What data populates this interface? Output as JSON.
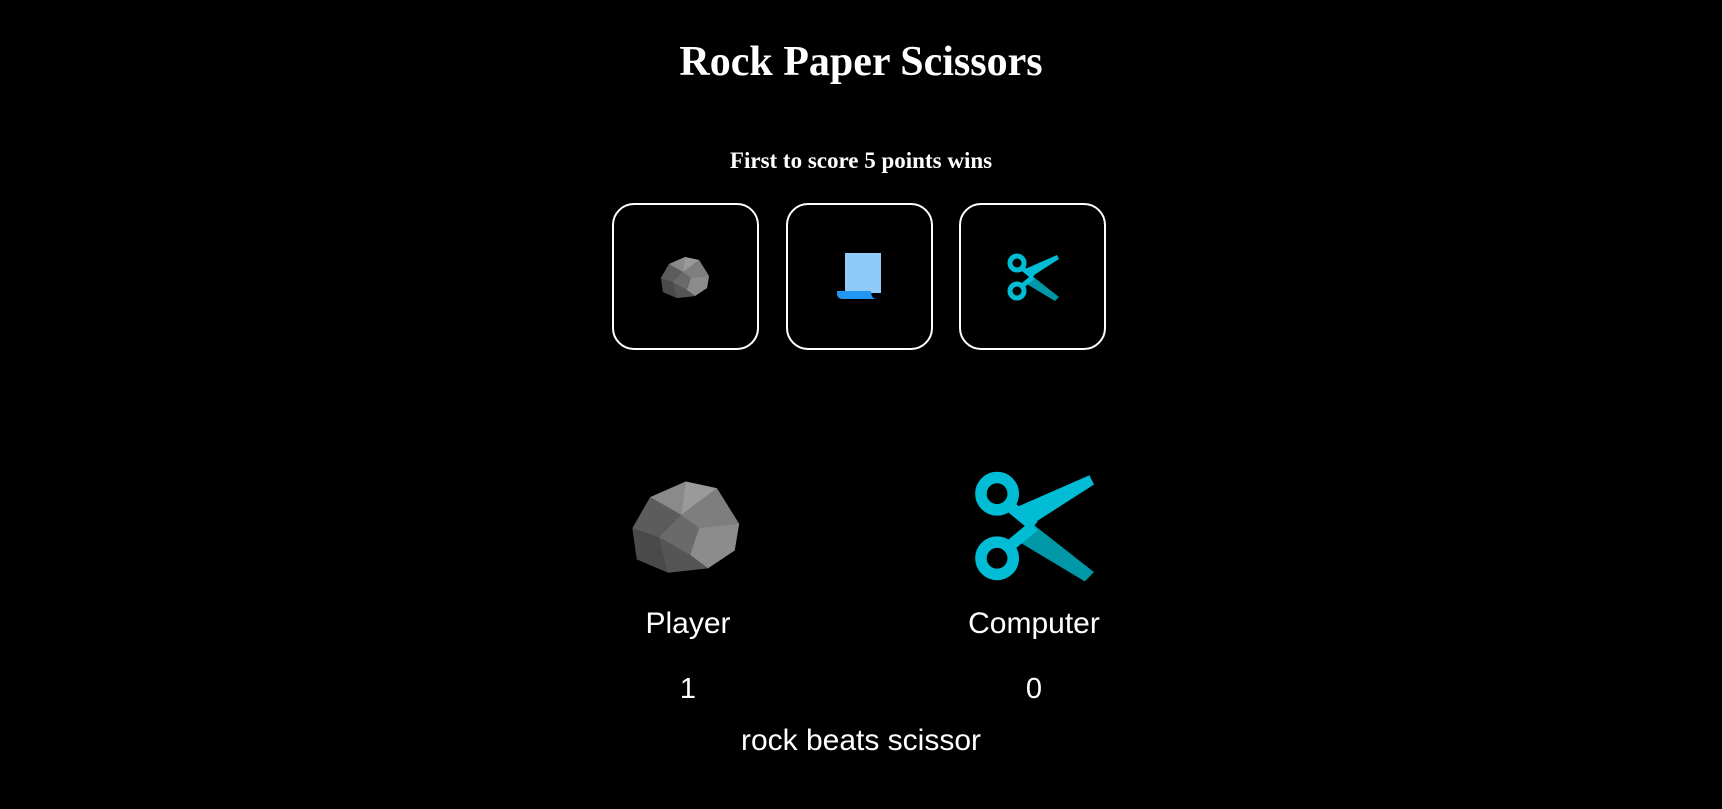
{
  "title": "Rock Paper Scissors",
  "subtitle": "First to score 5 points wins",
  "choices": [
    {
      "name": "rock",
      "icon": "rock-icon"
    },
    {
      "name": "paper",
      "icon": "paper-icon"
    },
    {
      "name": "scissors",
      "icon": "scissors-icon"
    }
  ],
  "player": {
    "label": "Player",
    "score": "1",
    "pick_icon": "rock-icon"
  },
  "computer": {
    "label": "Computer",
    "score": "0",
    "pick_icon": "scissors-icon"
  },
  "result": "rock beats scissor",
  "colors": {
    "background": "#000000",
    "text": "#ffffff",
    "rock": "#7a7a7a",
    "paper": "#90caf9",
    "scissors": "#00bcd4"
  }
}
